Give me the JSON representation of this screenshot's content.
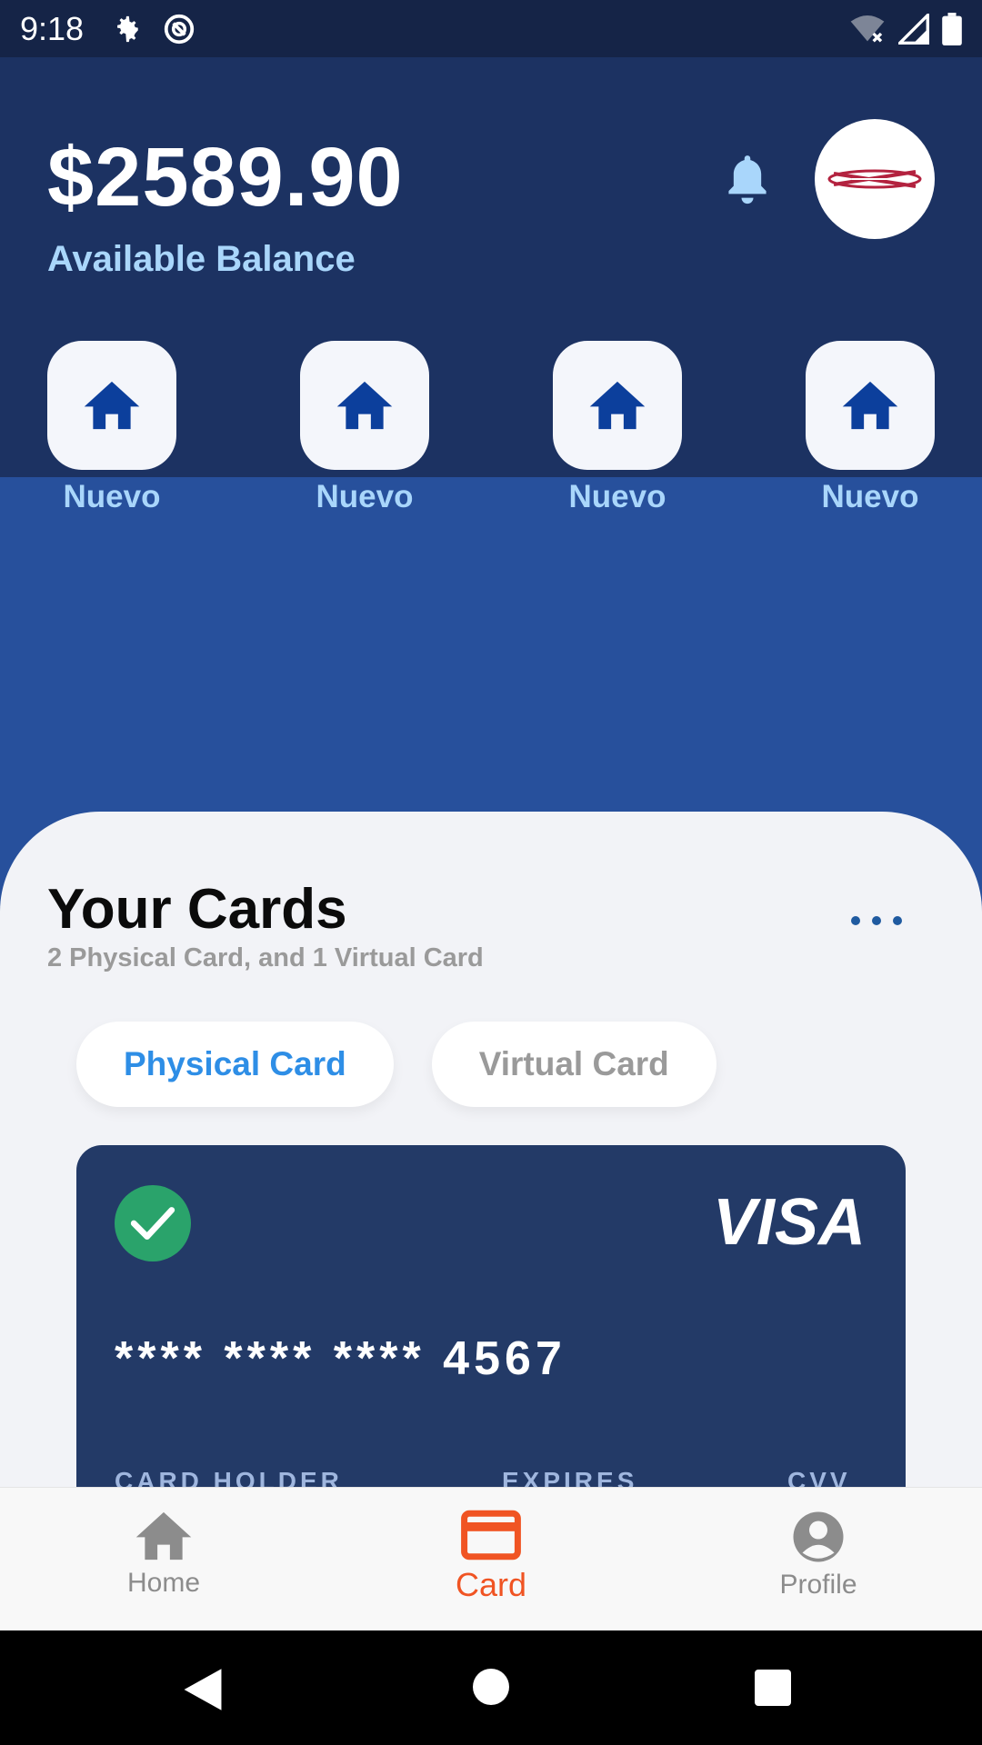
{
  "status_bar": {
    "time": "9:18",
    "icons_left": [
      "gear-icon",
      "sync-icon"
    ],
    "icons_right": [
      "wifi-off-icon",
      "signal-icon",
      "battery-icon"
    ]
  },
  "header": {
    "balance": "$2589.90",
    "balance_label": "Available Balance",
    "notification_icon": "bell-icon",
    "avatar_icon": "logo-icon"
  },
  "quick_actions": [
    {
      "label": "Nuevo",
      "icon": "home-icon"
    },
    {
      "label": "Nuevo",
      "icon": "home-icon"
    },
    {
      "label": "Nuevo",
      "icon": "home-icon"
    },
    {
      "label": "Nuevo",
      "icon": "home-icon"
    }
  ],
  "cards_section": {
    "title": "Your Cards",
    "subtitle": "2 Physical Card, and 1 Virtual Card",
    "more_icon": "more-dots-icon",
    "tabs": [
      {
        "label": "Physical Card",
        "active": true
      },
      {
        "label": "Virtual Card",
        "active": false
      }
    ],
    "card": {
      "brand": "VISA",
      "number": "**** **** **** 4567",
      "status_icon": "check-icon",
      "holder_label": "CARD HOLDER",
      "expires_label": "EXPIRES",
      "cvv_label": "CVV"
    }
  },
  "bottom_nav": {
    "items": [
      {
        "label": "Home",
        "icon": "home-icon",
        "active": false
      },
      {
        "label": "Card",
        "icon": "credit-card-icon",
        "active": true
      },
      {
        "label": "Profile",
        "icon": "user-icon",
        "active": false
      }
    ]
  },
  "colors": {
    "header_bg": "#1c3262",
    "body_bg": "#27509c",
    "accent": "#2e8ee6",
    "nav_active": "#f05423",
    "nav_inactive": "#8c8c8c",
    "card_bg": "#233a67",
    "check_green": "#2aa36b"
  }
}
